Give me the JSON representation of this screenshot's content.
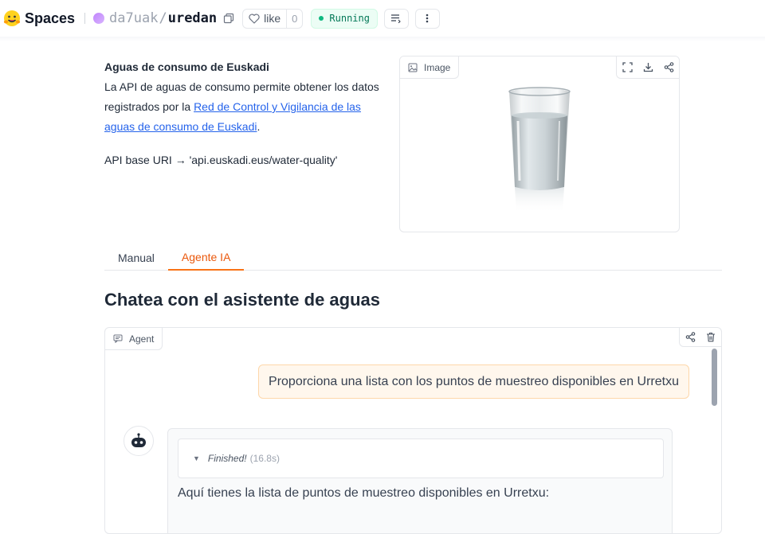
{
  "header": {
    "brand": "Spaces",
    "owner": "da7uak",
    "separator": "/",
    "repo": "uredan",
    "like_label": "like",
    "like_count": "0",
    "status": "Running",
    "status_color": "#10b981"
  },
  "intro": {
    "title": "Aguas de consumo de Euskadi",
    "text_before_link": "La API de aguas de consumo permite obtener los datos registrados por la ",
    "link_text": "Red de Control y Vigilancia de las aguas de consumo de Euskadi",
    "text_after_link": ".",
    "api_line": "API base URI → 'api.euskadi.eus/water-quality'"
  },
  "image_panel": {
    "label": "Image"
  },
  "tabs": [
    {
      "label": "Manual",
      "active": false
    },
    {
      "label": "Agente IA",
      "active": true
    }
  ],
  "chat": {
    "heading": "Chatea con el asistente de aguas",
    "panel_label": "Agent",
    "user_message": "Proporciona una lista con los puntos de muestreo disponibles en Urretxu",
    "thought_status": "Finished!",
    "thought_duration": "(16.8s)",
    "bot_message": "Aquí tienes la lista de puntos de muestreo disponibles en Urretxu:"
  },
  "colors": {
    "accent": "#f97316",
    "user_bubble_bg": "#fff7ed",
    "link": "#2563eb"
  }
}
